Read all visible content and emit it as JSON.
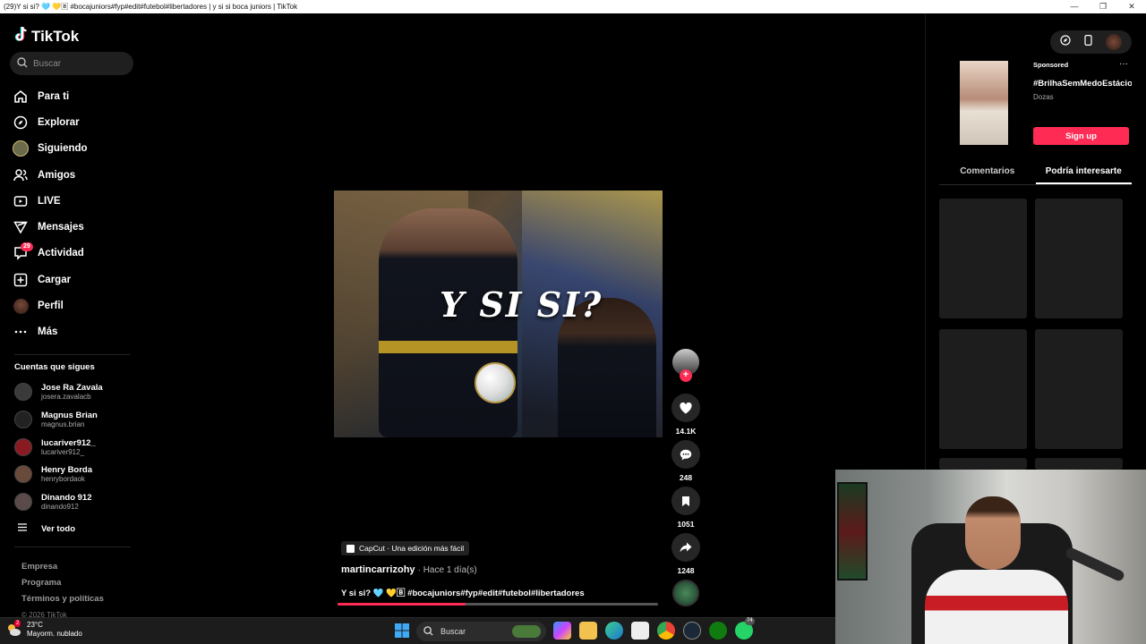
{
  "window": {
    "title": "(29)Y si si? 🩵 💛🄱 #bocajuniors#fyp#edit#futebol#libertadores | y si si boca juniors | TikTok",
    "minimize": "—",
    "maximize": "❐",
    "close": "✕"
  },
  "brand": {
    "logo_text": "TikTok"
  },
  "search": {
    "placeholder": "Buscar"
  },
  "nav": [
    {
      "label": "Para ti",
      "icon": "home-icon"
    },
    {
      "label": "Explorar",
      "icon": "compass-icon"
    },
    {
      "label": "Siguiendo",
      "icon": "following-avatar-icon"
    },
    {
      "label": "Amigos",
      "icon": "friends-icon"
    },
    {
      "label": "LIVE",
      "icon": "live-icon"
    },
    {
      "label": "Mensajes",
      "icon": "messages-icon"
    },
    {
      "label": "Actividad",
      "icon": "activity-icon",
      "badge": "29"
    },
    {
      "label": "Cargar",
      "icon": "upload-icon"
    },
    {
      "label": "Perfil",
      "icon": "profile-icon"
    },
    {
      "label": "Más",
      "icon": "more-icon"
    }
  ],
  "following": {
    "title": "Cuentas que sigues",
    "accounts": [
      {
        "name": "Jose Ra Zavala",
        "user": "josera.zavalacb"
      },
      {
        "name": "Magnus Brian",
        "user": "magnus.brian"
      },
      {
        "name": "lucariver912_",
        "user": "lucariver912_"
      },
      {
        "name": "Henry Borda",
        "user": "henrybordaok"
      },
      {
        "name": "Dinando 912",
        "user": "dinando912"
      }
    ],
    "see_all": "Ver todo"
  },
  "footer": {
    "links": [
      "Empresa",
      "Programa",
      "Términos y políticas"
    ],
    "copyright": "© 2026 TikTok"
  },
  "video": {
    "overlay_text": "Y SI SI?",
    "capcut_label": "CapCut · Una edición más fácil",
    "author": "martincarrizohy",
    "time": "· Hace 1 día(s)",
    "caption": "Y si si? 🩵 💛🄱 #bocajuniors#fyp#edit#futebol#libertadores",
    "progress": 0.4
  },
  "actions": {
    "likes": "14.1K",
    "comments": "248",
    "saves": "1051",
    "shares": "1248"
  },
  "ad": {
    "sponsored": "Sponsored",
    "title": "#BrilhaSemMedoEstácio",
    "brand": "Dozas",
    "cta": "Sign up"
  },
  "right_tabs": [
    {
      "label": "Comentarios",
      "active": false
    },
    {
      "label": "Podría interesarte",
      "active": true
    }
  ],
  "taskbar": {
    "temp": "23°C",
    "weather": "Mayorm. nublado",
    "weather_badge": "2",
    "search": "Buscar",
    "whatsapp_badge": "74"
  },
  "colors": {
    "accent": "#fe2c55",
    "background": "#000000",
    "surface": "#1f1f1f"
  }
}
